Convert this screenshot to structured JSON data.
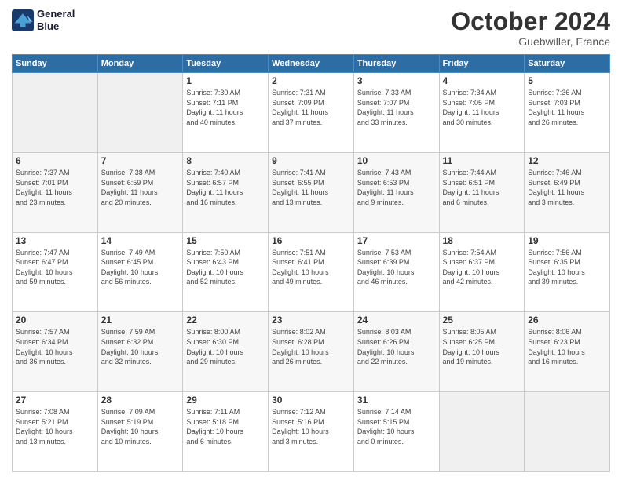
{
  "header": {
    "logo_line1": "General",
    "logo_line2": "Blue",
    "month": "October 2024",
    "location": "Guebwiller, France"
  },
  "weekdays": [
    "Sunday",
    "Monday",
    "Tuesday",
    "Wednesday",
    "Thursday",
    "Friday",
    "Saturday"
  ],
  "weeks": [
    [
      {
        "num": "",
        "info": ""
      },
      {
        "num": "",
        "info": ""
      },
      {
        "num": "1",
        "info": "Sunrise: 7:30 AM\nSunset: 7:11 PM\nDaylight: 11 hours\nand 40 minutes."
      },
      {
        "num": "2",
        "info": "Sunrise: 7:31 AM\nSunset: 7:09 PM\nDaylight: 11 hours\nand 37 minutes."
      },
      {
        "num": "3",
        "info": "Sunrise: 7:33 AM\nSunset: 7:07 PM\nDaylight: 11 hours\nand 33 minutes."
      },
      {
        "num": "4",
        "info": "Sunrise: 7:34 AM\nSunset: 7:05 PM\nDaylight: 11 hours\nand 30 minutes."
      },
      {
        "num": "5",
        "info": "Sunrise: 7:36 AM\nSunset: 7:03 PM\nDaylight: 11 hours\nand 26 minutes."
      }
    ],
    [
      {
        "num": "6",
        "info": "Sunrise: 7:37 AM\nSunset: 7:01 PM\nDaylight: 11 hours\nand 23 minutes."
      },
      {
        "num": "7",
        "info": "Sunrise: 7:38 AM\nSunset: 6:59 PM\nDaylight: 11 hours\nand 20 minutes."
      },
      {
        "num": "8",
        "info": "Sunrise: 7:40 AM\nSunset: 6:57 PM\nDaylight: 11 hours\nand 16 minutes."
      },
      {
        "num": "9",
        "info": "Sunrise: 7:41 AM\nSunset: 6:55 PM\nDaylight: 11 hours\nand 13 minutes."
      },
      {
        "num": "10",
        "info": "Sunrise: 7:43 AM\nSunset: 6:53 PM\nDaylight: 11 hours\nand 9 minutes."
      },
      {
        "num": "11",
        "info": "Sunrise: 7:44 AM\nSunset: 6:51 PM\nDaylight: 11 hours\nand 6 minutes."
      },
      {
        "num": "12",
        "info": "Sunrise: 7:46 AM\nSunset: 6:49 PM\nDaylight: 11 hours\nand 3 minutes."
      }
    ],
    [
      {
        "num": "13",
        "info": "Sunrise: 7:47 AM\nSunset: 6:47 PM\nDaylight: 10 hours\nand 59 minutes."
      },
      {
        "num": "14",
        "info": "Sunrise: 7:49 AM\nSunset: 6:45 PM\nDaylight: 10 hours\nand 56 minutes."
      },
      {
        "num": "15",
        "info": "Sunrise: 7:50 AM\nSunset: 6:43 PM\nDaylight: 10 hours\nand 52 minutes."
      },
      {
        "num": "16",
        "info": "Sunrise: 7:51 AM\nSunset: 6:41 PM\nDaylight: 10 hours\nand 49 minutes."
      },
      {
        "num": "17",
        "info": "Sunrise: 7:53 AM\nSunset: 6:39 PM\nDaylight: 10 hours\nand 46 minutes."
      },
      {
        "num": "18",
        "info": "Sunrise: 7:54 AM\nSunset: 6:37 PM\nDaylight: 10 hours\nand 42 minutes."
      },
      {
        "num": "19",
        "info": "Sunrise: 7:56 AM\nSunset: 6:35 PM\nDaylight: 10 hours\nand 39 minutes."
      }
    ],
    [
      {
        "num": "20",
        "info": "Sunrise: 7:57 AM\nSunset: 6:34 PM\nDaylight: 10 hours\nand 36 minutes."
      },
      {
        "num": "21",
        "info": "Sunrise: 7:59 AM\nSunset: 6:32 PM\nDaylight: 10 hours\nand 32 minutes."
      },
      {
        "num": "22",
        "info": "Sunrise: 8:00 AM\nSunset: 6:30 PM\nDaylight: 10 hours\nand 29 minutes."
      },
      {
        "num": "23",
        "info": "Sunrise: 8:02 AM\nSunset: 6:28 PM\nDaylight: 10 hours\nand 26 minutes."
      },
      {
        "num": "24",
        "info": "Sunrise: 8:03 AM\nSunset: 6:26 PM\nDaylight: 10 hours\nand 22 minutes."
      },
      {
        "num": "25",
        "info": "Sunrise: 8:05 AM\nSunset: 6:25 PM\nDaylight: 10 hours\nand 19 minutes."
      },
      {
        "num": "26",
        "info": "Sunrise: 8:06 AM\nSunset: 6:23 PM\nDaylight: 10 hours\nand 16 minutes."
      }
    ],
    [
      {
        "num": "27",
        "info": "Sunrise: 7:08 AM\nSunset: 5:21 PM\nDaylight: 10 hours\nand 13 minutes."
      },
      {
        "num": "28",
        "info": "Sunrise: 7:09 AM\nSunset: 5:19 PM\nDaylight: 10 hours\nand 10 minutes."
      },
      {
        "num": "29",
        "info": "Sunrise: 7:11 AM\nSunset: 5:18 PM\nDaylight: 10 hours\nand 6 minutes."
      },
      {
        "num": "30",
        "info": "Sunrise: 7:12 AM\nSunset: 5:16 PM\nDaylight: 10 hours\nand 3 minutes."
      },
      {
        "num": "31",
        "info": "Sunrise: 7:14 AM\nSunset: 5:15 PM\nDaylight: 10 hours\nand 0 minutes."
      },
      {
        "num": "",
        "info": ""
      },
      {
        "num": "",
        "info": ""
      }
    ]
  ]
}
